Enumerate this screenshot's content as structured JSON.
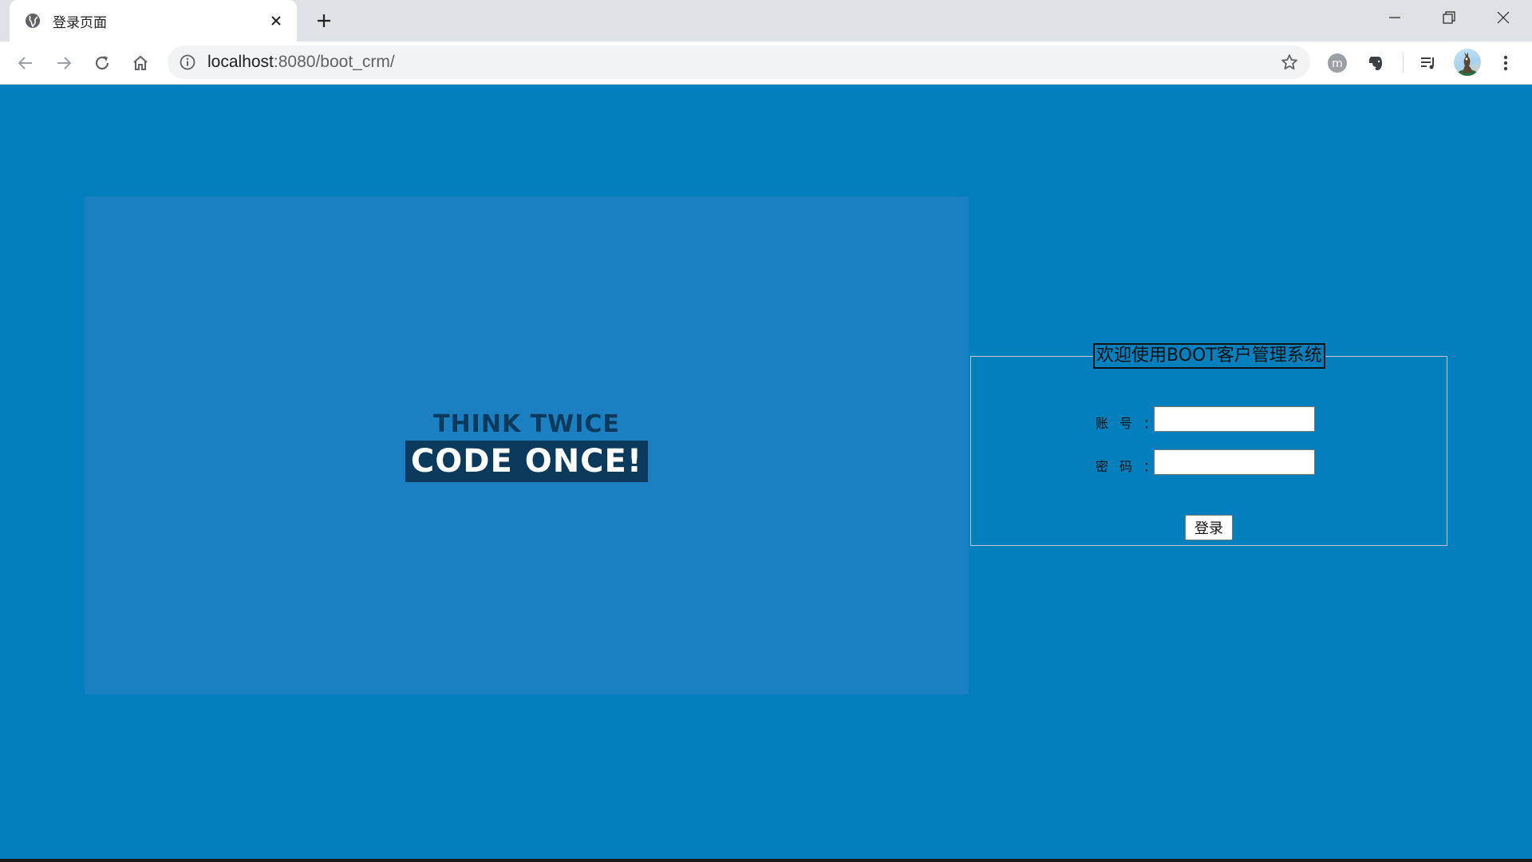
{
  "browser": {
    "tab": {
      "title": "登录页面",
      "favicon": "globe-icon"
    },
    "address": {
      "host": "localhost",
      "rest": ":8080/boot_crm/"
    },
    "icons": {
      "back": "arrow-left-icon",
      "forward": "arrow-right-icon",
      "reload": "reload-icon",
      "home": "home-icon",
      "info": "info-icon",
      "bookmark": "star-icon",
      "extension_1": "m-circle-icon",
      "extension_2": "evernote-icon",
      "media": "playlist-icon",
      "menu": "kebab-menu-icon"
    },
    "colors": {
      "tabstrip": "#dee1e6",
      "toolbar": "#ffffff",
      "omnibox": "#f1f3f4"
    }
  },
  "page": {
    "background": "#027fbd",
    "banner": {
      "line1": "THINK TWICE",
      "line2": "CODE ONCE!",
      "background": "#1a80c1",
      "text_color": "#0c3a5c"
    },
    "login": {
      "legend": "欢迎使用BOOT客户管理系统",
      "account_label": "账号：",
      "account_value": "",
      "password_label": "密码：",
      "password_value": "",
      "submit_label": "登录"
    }
  }
}
